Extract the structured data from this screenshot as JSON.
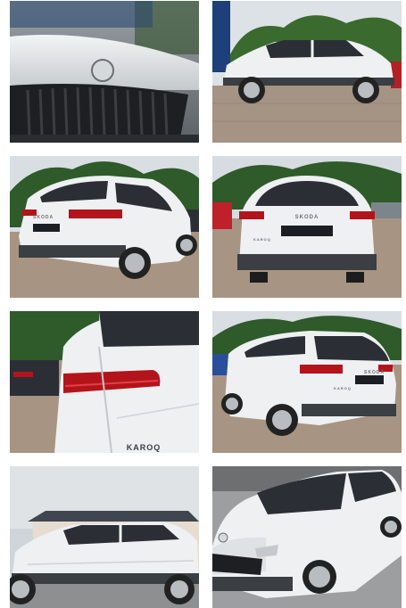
{
  "gallery": {
    "tiles": [
      {
        "id": "front-grille-closeup",
        "badge": ""
      },
      {
        "id": "side-profile-right",
        "badge": ""
      },
      {
        "id": "rear-left-three-quarter",
        "badge": "SKODA",
        "plate": ""
      },
      {
        "id": "rear-straight",
        "badge": "SKODA",
        "model": "KAROQ",
        "plate": ""
      },
      {
        "id": "taillight-closeup",
        "model": "KAROQ"
      },
      {
        "id": "rear-right-three-quarter",
        "badge": "SKODA",
        "model": "KAROQ",
        "plate": ""
      },
      {
        "id": "side-profile-left-building"
      },
      {
        "id": "front-left-three-quarter"
      }
    ]
  },
  "colors": {
    "car_white": "#eef0f2",
    "car_shadow": "#c9cdd2",
    "glass": "#2b2f35",
    "taillight": "#b3141b",
    "foliage": "#2f5a2a",
    "pavement": "#a89483",
    "sky": "#dfe3e6"
  }
}
